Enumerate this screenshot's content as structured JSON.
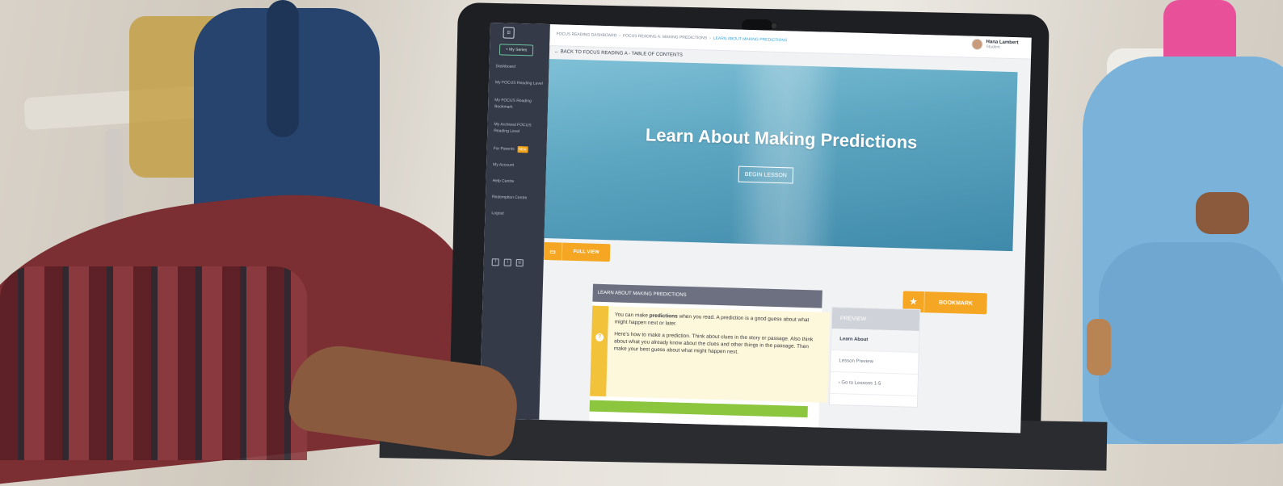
{
  "sidebar": {
    "logo_text": "⊡",
    "series_button": "+ My Series",
    "items": [
      {
        "label": "Dashboard"
      },
      {
        "label": "My FOCUS Reading Level"
      },
      {
        "label": "My FOCUS Reading Bookmark"
      },
      {
        "label": "My Archived FOCUS Reading Level"
      },
      {
        "label": "For Parents",
        "badge": "NEW"
      },
      {
        "label": "My Account"
      },
      {
        "label": "Help Centre"
      },
      {
        "label": "Redemption Centre"
      },
      {
        "label": "Logout"
      }
    ],
    "social_icons": [
      "facebook-icon",
      "twitter-icon",
      "instagram-icon"
    ]
  },
  "topbar": {
    "breadcrumb": [
      "FOCUS READING DASHBOARD",
      "FOCUS READING A: MAKING PREDICTIONS",
      "LEARN ABOUT MAKING PREDICTIONS"
    ],
    "user": {
      "name": "Hana Lambert",
      "role": "Student"
    }
  },
  "back_link": "BACK TO FOCUS READING A - TABLE OF CONTENTS",
  "hero": {
    "title": "Learn About Making Predictions",
    "begin_button": "BEGIN LESSON"
  },
  "fullview_button": "FULL VIEW",
  "bookmark_button": "BOOKMARK",
  "lesson": {
    "header": "LEARN ABOUT MAKING PREDICTIONS",
    "p1_pre": "You can make ",
    "p1_bold": "predictions",
    "p1_post": " when you read. A prediction is a good guess about what might happen next or later.",
    "p2": "Here's how to make a prediction. Think about clues in the story or passage. Also think about what you already know about the clues and other things in the passage. Then make your best guess about what might happen next."
  },
  "preview": {
    "header": "PREVIEW",
    "items": [
      "Learn About",
      "Lesson Preview",
      "Go to Lessons 1-5"
    ]
  },
  "colors": {
    "accent_orange": "#f5a623",
    "link_blue": "#3ba3d6",
    "sidebar_bg": "#343a48",
    "green": "#8cc63f"
  }
}
